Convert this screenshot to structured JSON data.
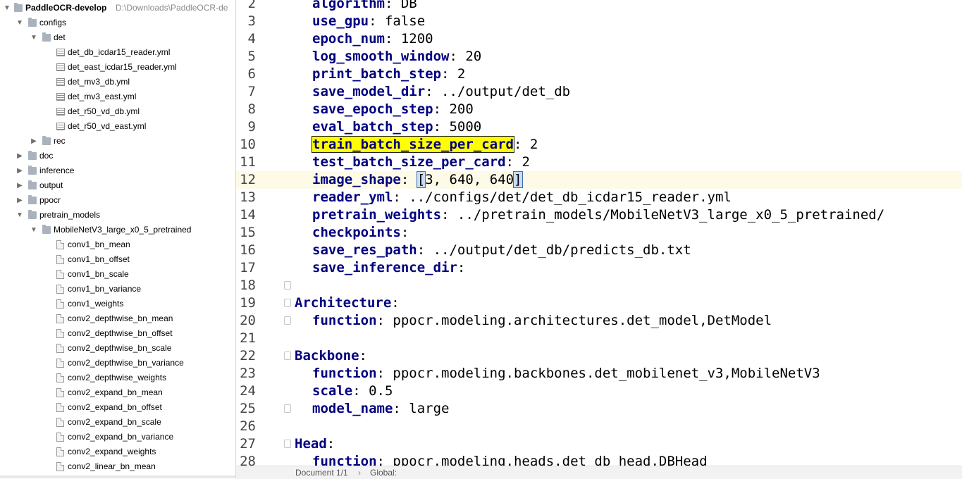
{
  "tree": {
    "root_label": "PaddleOCR-develop",
    "root_path": "D:\\Downloads\\PaddleOCR-de",
    "items": [
      {
        "label": "configs",
        "kind": "folder",
        "expanded": true
      },
      {
        "label": "det",
        "kind": "folder",
        "expanded": true
      },
      {
        "label": "det_db_icdar15_reader.yml",
        "kind": "yml"
      },
      {
        "label": "det_east_icdar15_reader.yml",
        "kind": "yml"
      },
      {
        "label": "det_mv3_db.yml",
        "kind": "yml"
      },
      {
        "label": "det_mv3_east.yml",
        "kind": "yml"
      },
      {
        "label": "det_r50_vd_db.yml",
        "kind": "yml"
      },
      {
        "label": "det_r50_vd_east.yml",
        "kind": "yml"
      },
      {
        "label": "rec",
        "kind": "folder",
        "expanded": false
      },
      {
        "label": "doc",
        "kind": "folder",
        "expanded": false
      },
      {
        "label": "inference",
        "kind": "folder",
        "expanded": false
      },
      {
        "label": "output",
        "kind": "folder",
        "expanded": false
      },
      {
        "label": "ppocr",
        "kind": "folder",
        "expanded": false
      },
      {
        "label": "pretrain_models",
        "kind": "folder",
        "expanded": true
      },
      {
        "label": "MobileNetV3_large_x0_5_pretrained",
        "kind": "folder",
        "expanded": true
      },
      {
        "label": "conv1_bn_mean",
        "kind": "file"
      },
      {
        "label": "conv1_bn_offset",
        "kind": "file"
      },
      {
        "label": "conv1_bn_scale",
        "kind": "file"
      },
      {
        "label": "conv1_bn_variance",
        "kind": "file"
      },
      {
        "label": "conv1_weights",
        "kind": "file"
      },
      {
        "label": "conv2_depthwise_bn_mean",
        "kind": "file"
      },
      {
        "label": "conv2_depthwise_bn_offset",
        "kind": "file"
      },
      {
        "label": "conv2_depthwise_bn_scale",
        "kind": "file"
      },
      {
        "label": "conv2_depthwise_bn_variance",
        "kind": "file"
      },
      {
        "label": "conv2_depthwise_weights",
        "kind": "file"
      },
      {
        "label": "conv2_expand_bn_mean",
        "kind": "file"
      },
      {
        "label": "conv2_expand_bn_offset",
        "kind": "file"
      },
      {
        "label": "conv2_expand_bn_scale",
        "kind": "file"
      },
      {
        "label": "conv2_expand_bn_variance",
        "kind": "file"
      },
      {
        "label": "conv2_expand_weights",
        "kind": "file"
      },
      {
        "label": "conv2_linear_bn_mean",
        "kind": "file"
      }
    ]
  },
  "editor": {
    "lines": [
      {
        "n": "2",
        "key": "algorithm",
        "value": " DB"
      },
      {
        "n": "3",
        "key": "use_gpu",
        "value": " false"
      },
      {
        "n": "4",
        "key": "epoch_num",
        "value": " 1200"
      },
      {
        "n": "5",
        "key": "log_smooth_window",
        "value": " 20"
      },
      {
        "n": "6",
        "key": "print_batch_step",
        "value": " 2"
      },
      {
        "n": "7",
        "key": "save_model_dir",
        "value": " ../output/det_db"
      },
      {
        "n": "8",
        "key": "save_epoch_step",
        "value": " 200"
      },
      {
        "n": "9",
        "key": "eval_batch_step",
        "value": " 5000"
      },
      {
        "n": "10",
        "key": "train_batch_size_per_card",
        "value": " 2"
      },
      {
        "n": "11",
        "key": "test_batch_size_per_card",
        "value": " 2"
      },
      {
        "n": "12",
        "key": "image_shape",
        "value": " ",
        "br_open": "[",
        "inner": "3, 640, 640",
        "br_close": "]"
      },
      {
        "n": "13",
        "key": "reader_yml",
        "value": " ../configs/det/det_db_icdar15_reader.yml"
      },
      {
        "n": "14",
        "key": "pretrain_weights",
        "value": " ../pretrain_models/MobileNetV3_large_x0_5_pretrained/"
      },
      {
        "n": "15",
        "key": "checkpoints",
        "value": ""
      },
      {
        "n": "16",
        "key": "save_res_path",
        "value": " ../output/det_db/predicts_db.txt"
      },
      {
        "n": "17",
        "key": "save_inference_dir",
        "value": ""
      },
      {
        "n": "18",
        "key": "",
        "value": ""
      },
      {
        "n": "19",
        "key": "Architecture",
        "value": ""
      },
      {
        "n": "20",
        "key": "function",
        "value": " ppocr.modeling.architectures.det_model,DetModel"
      },
      {
        "n": "21",
        "key": "",
        "value": ""
      },
      {
        "n": "22",
        "key": "Backbone",
        "value": ""
      },
      {
        "n": "23",
        "key": "function",
        "value": " ppocr.modeling.backbones.det_mobilenet_v3,MobileNetV3"
      },
      {
        "n": "24",
        "key": "scale",
        "value": " 0.5"
      },
      {
        "n": "25",
        "key": "model_name",
        "value": " large"
      },
      {
        "n": "26",
        "key": "",
        "value": ""
      },
      {
        "n": "27",
        "key": "Head",
        "value": ""
      },
      {
        "n": "28",
        "key": "function",
        "value": " ppocr.modeling.heads.det_db_head,DBHead"
      }
    ]
  },
  "statusbar": {
    "document": "Document 1/1",
    "separator": "›",
    "scope": "Global:"
  }
}
